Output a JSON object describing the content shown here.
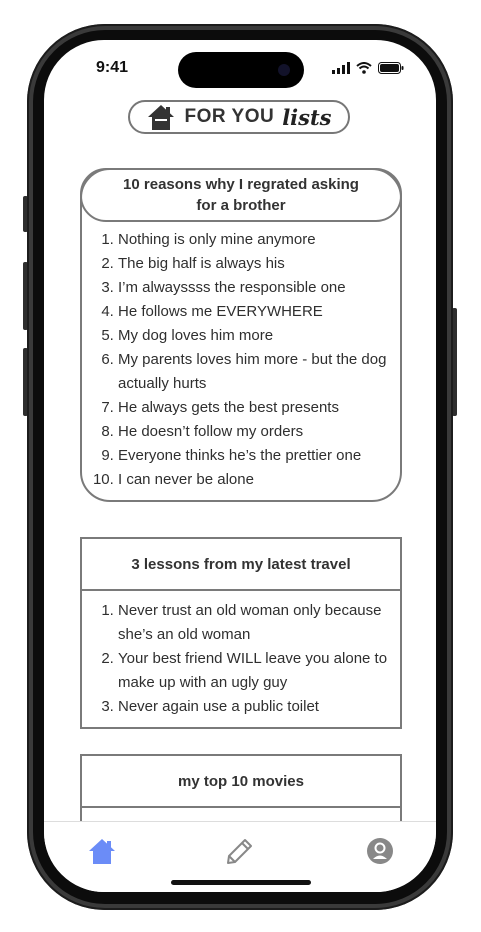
{
  "status_bar": {
    "time": "9:41"
  },
  "header": {
    "title": "FOR YOU",
    "script": "lists",
    "icon": "home-icon"
  },
  "cards": [
    {
      "title": "10 reasons why I regrated asking for a brother",
      "items": [
        "Nothing is only mine anymore",
        "The big half is always his",
        "I’m alwayssss the responsible one",
        "He follows me EVERYWHERE",
        "My dog loves him more",
        "My parents loves him more - but the dog actually hurts",
        "He always gets the best presents",
        "He doesn’t follow my orders",
        "Everyone thinks he’s the prettier one",
        "I can never be alone"
      ]
    },
    {
      "title": "3 lessons from my latest travel",
      "items": [
        "Never trust an old woman only because she’s an old woman",
        "Your best friend WILL leave you alone to make up with an ugly guy",
        "Never again use a public toilet"
      ]
    },
    {
      "title": "my top 10 movies",
      "items": []
    }
  ],
  "tabbar": {
    "tabs": [
      {
        "icon": "home-icon",
        "active": true
      },
      {
        "icon": "pencil-icon",
        "active": false
      },
      {
        "icon": "profile-icon",
        "active": false
      }
    ],
    "active_color": "#6b8cf7",
    "inactive_color": "#888888"
  }
}
